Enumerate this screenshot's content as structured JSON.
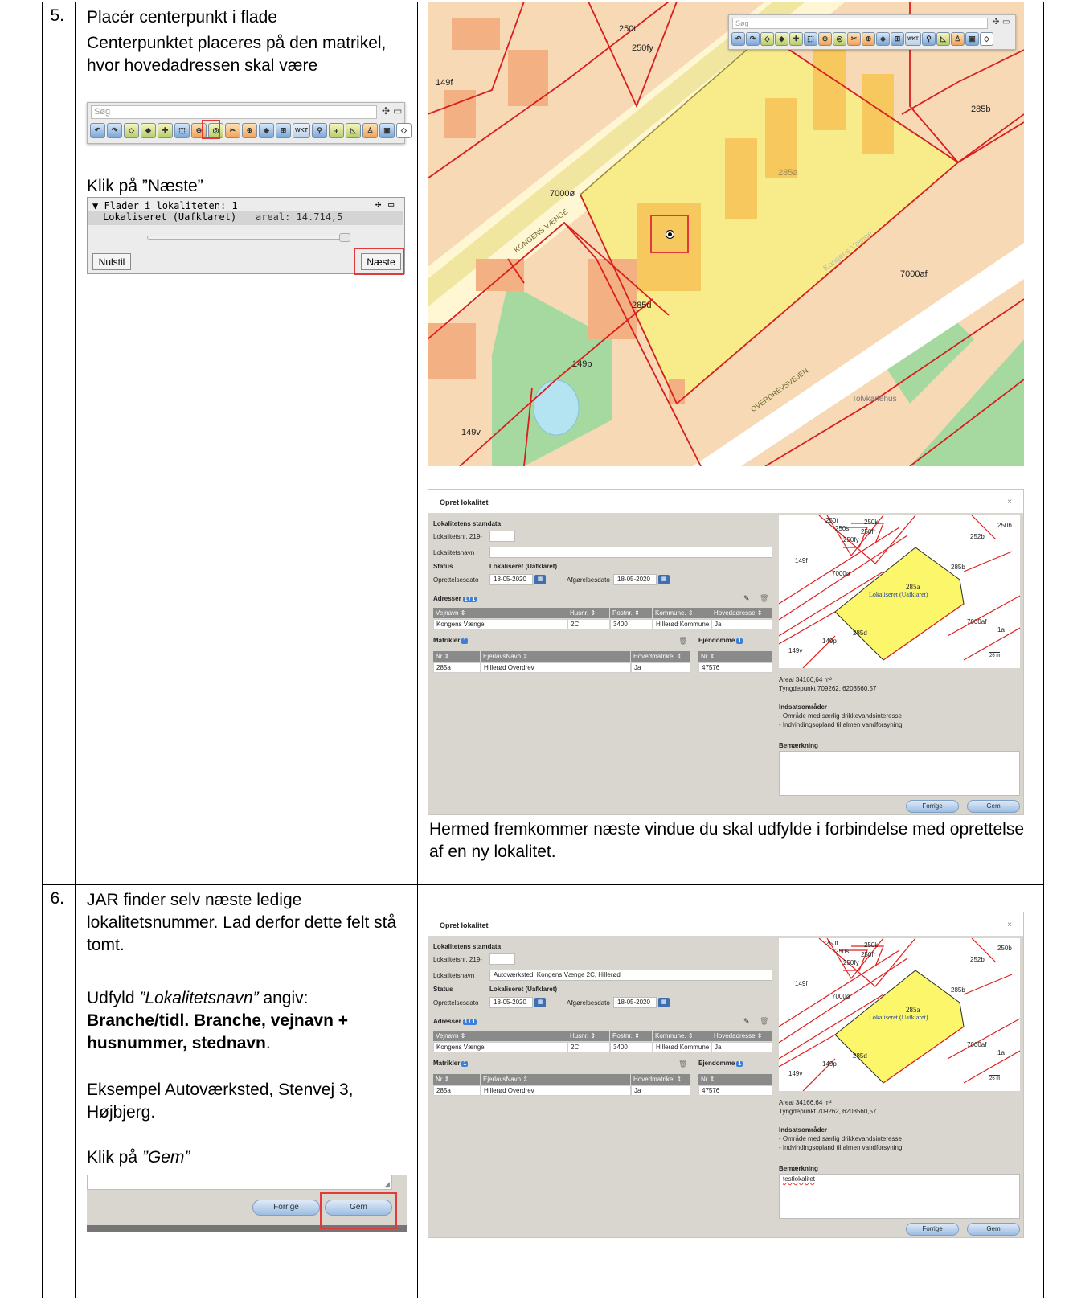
{
  "steps": [
    {
      "number": "5.",
      "title": "Placér centerpunkt i flade",
      "description": "Centerpunktet placeres på den matrikel, hvor hovedadressen skal være",
      "next_instruction": "Klik på ”Næste”",
      "bottom_text": "Hermed fremkommer næste vindue du skal udfylde i forbindelse med oprettelse af en ny lokalitet."
    },
    {
      "number": "6.",
      "text_1": "JAR finder selv næste ledige lokalitetsnummer. Lad derfor dette felt stå tomt.",
      "text_2_prefix": "Udfyld ",
      "text_2_italic": "”Lokalitetsnavn”",
      "text_2_suffix": " angiv:",
      "text_2_bold": "Branche/tidl. Branche, vejnavn + husnummer, stednavn",
      "text_2_end": ".",
      "text_3": "Eksempel Autoværksted, Stenvej 3, Højbjerg.",
      "text_4_prefix": "Klik på ",
      "text_4_italic": "”Gem”"
    }
  ],
  "toolbar": {
    "search_placeholder": "Søg",
    "move_glyph": "✣",
    "min_glyph": "▭",
    "wkt_label": "WKT"
  },
  "flader_panel": {
    "header": "▼ Flader i lokaliteten: 1",
    "item_name": "Lokaliseret (Uafklaret)",
    "item_area": "areal: 14.714,5",
    "reset_button": "Nulstil",
    "next_button": "Næste"
  },
  "map_labels": [
    "250t",
    "250fy",
    "149f",
    "285b",
    "285a",
    "7000ø",
    "KONGENS VÆNGE",
    "Kongens Vænge",
    "7000af",
    "285d",
    "149p",
    "OVERDREVSVEJEN",
    "Tolvkarlehus",
    "149v"
  ],
  "dialog": {
    "title": "Opret lokalitet",
    "close": "×",
    "section_stamdata": "Lokalitetens stamdata",
    "lokalitetsnr_label": "Lokalitetsnr. 219-",
    "lokalitetsnavn_label": "Lokalitetsnavn",
    "status_label": "Status",
    "status_value": "Lokaliseret (Uafklaret)",
    "oprettelsesdato_label": "Oprettelsesdato",
    "oprettelsesdato_value": "18-05-2020",
    "afgoerelsesdato_label": "Afgørelsesdato",
    "afgoerelsesdato_value": "18-05-2020",
    "adresser_label": "Adresser",
    "adresser_badge": "1 / 1",
    "adresser_headers": [
      "Vejnavn ⇕",
      "Husnr. ⇕",
      "Postnr. ⇕",
      "Kommune. ⇕",
      "Hovedadresse ⇕"
    ],
    "adresser_row": [
      "Kongens Vænge",
      "2C",
      "3400",
      "Hillerød Kommune",
      "Ja"
    ],
    "matrikler_label": "Matrikler",
    "matrikler_badge": "1",
    "matrikler_headers": [
      "Nr ⇕",
      "EjerlavsNavn ⇕",
      "Hovedmatrikel ⇕"
    ],
    "matrikler_row": [
      "285a",
      "Hillerød Overdrev",
      "Ja"
    ],
    "ejendomme_label": "Ejendomme",
    "ejendomme_badge": "1",
    "ejendomme_header": "Nr ⇕",
    "ejendomme_row": "47576",
    "areal": "Areal 34166,64 m²",
    "tyngdepunkt": "Tyngdepunkt 709262, 6203560,57",
    "indsats_label": "Indsatsområder",
    "indsats_1": "- Område med særlig drikkevandsinteresse",
    "indsats_2": "- Indvindingsopland til almen vandforsyning",
    "bemaerkning_label": "Bemærkning",
    "forrige_button": "Forrige",
    "gem_button": "Gem",
    "minimap_labels": [
      "250t",
      "250k",
      "250s",
      "250b",
      "252b",
      "250fr",
      "250fy",
      "149f",
      "7000ø",
      "285b",
      "285a",
      "Lokaliseret (Uafklaret)",
      "7000af",
      "1a",
      "285d",
      "149p",
      "149v",
      "26 m"
    ]
  },
  "dialog2": {
    "lokalitetsnavn_value": "Autoværksted, Kongens Vænge 2C, Hillerød",
    "bemaerkning_value": "testlokalitet"
  },
  "colors": {
    "red_highlight": "#e03a3a",
    "map_parcel": "#f7d9b6",
    "map_selected": "#f7eb8a",
    "map_green": "#a6d9a0",
    "dialog_bg": "#d9d6d0"
  }
}
